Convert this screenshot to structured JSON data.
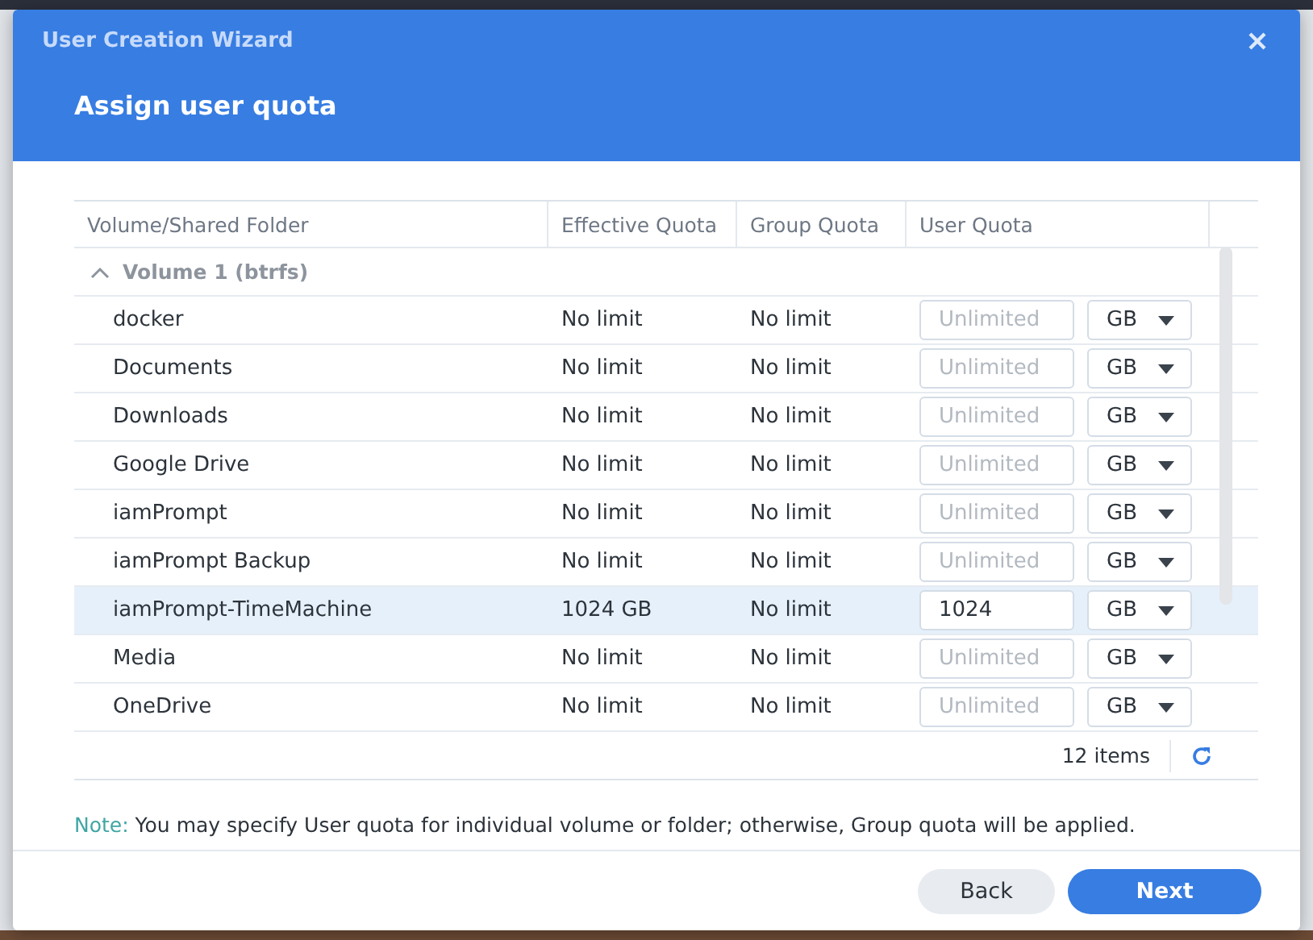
{
  "window": {
    "title": "User Creation Wizard",
    "heading": "Assign user quota"
  },
  "table": {
    "columns": [
      "Volume/Shared Folder",
      "Effective Quota",
      "Group Quota",
      "User Quota"
    ],
    "group": {
      "label": "Volume 1 (btrfs)",
      "expanded": true
    },
    "rows": [
      {
        "folder": "docker",
        "effective": "No limit",
        "group": "No limit",
        "quota": {
          "placeholder": "Unlimited"
        },
        "unit": "GB",
        "selected": false
      },
      {
        "folder": "Documents",
        "effective": "No limit",
        "group": "No limit",
        "quota": {
          "placeholder": "Unlimited"
        },
        "unit": "GB",
        "selected": false
      },
      {
        "folder": "Downloads",
        "effective": "No limit",
        "group": "No limit",
        "quota": {
          "placeholder": "Unlimited"
        },
        "unit": "GB",
        "selected": false
      },
      {
        "folder": "Google Drive",
        "effective": "No limit",
        "group": "No limit",
        "quota": {
          "placeholder": "Unlimited"
        },
        "unit": "GB",
        "selected": false
      },
      {
        "folder": "iamPrompt",
        "effective": "No limit",
        "group": "No limit",
        "quota": {
          "placeholder": "Unlimited"
        },
        "unit": "GB",
        "selected": false
      },
      {
        "folder": "iamPrompt Backup",
        "effective": "No limit",
        "group": "No limit",
        "quota": {
          "placeholder": "Unlimited"
        },
        "unit": "GB",
        "selected": false
      },
      {
        "folder": "iamPrompt-TimeMachine",
        "effective": "1024 GB",
        "group": "No limit",
        "quota": {
          "value": "1024"
        },
        "unit": "GB",
        "selected": true
      },
      {
        "folder": "Media",
        "effective": "No limit",
        "group": "No limit",
        "quota": {
          "placeholder": "Unlimited"
        },
        "unit": "GB",
        "selected": false
      },
      {
        "folder": "OneDrive",
        "effective": "No limit",
        "group": "No limit",
        "quota": {
          "placeholder": "Unlimited"
        },
        "unit": "GB",
        "selected": false
      }
    ],
    "count": "12 items"
  },
  "note": {
    "label": "Note:",
    "text": "You may specify User quota for individual volume or folder; otherwise, Group quota will be applied."
  },
  "buttons": [
    {
      "label": "Back",
      "kind": "secondary"
    },
    {
      "label": "Next",
      "kind": "primary"
    }
  ]
}
